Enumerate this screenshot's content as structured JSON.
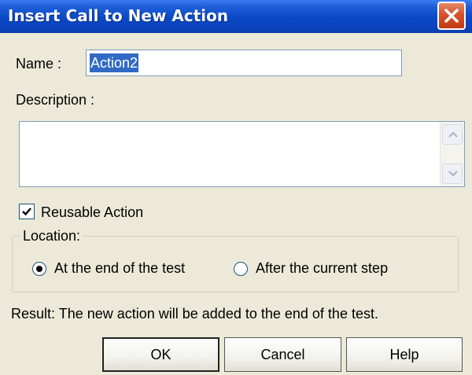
{
  "window": {
    "title": "Insert Call to New Action"
  },
  "form": {
    "name_label": "Name :",
    "name_value": "Action2",
    "description_label": "Description :",
    "description_value": "",
    "reusable_label": "Reusable Action",
    "reusable_checked": true
  },
  "location": {
    "legend": "Location:",
    "options": [
      {
        "label": "At the end of the test",
        "selected": true
      },
      {
        "label": "After the current step",
        "selected": false
      }
    ]
  },
  "result_text": "Result: The new action will be added to the end of the test.",
  "buttons": {
    "ok": "OK",
    "cancel": "Cancel",
    "help": "Help"
  },
  "icons": {
    "close": "close-icon",
    "scroll_up": "scroll-up-icon",
    "scroll_down": "scroll-down-icon",
    "check": "checkmark-icon"
  },
  "colors": {
    "titlebar": "#0a48c6",
    "selection": "#316ac5",
    "dialog_bg": "#ece9d8",
    "close_button": "#d5522c"
  }
}
